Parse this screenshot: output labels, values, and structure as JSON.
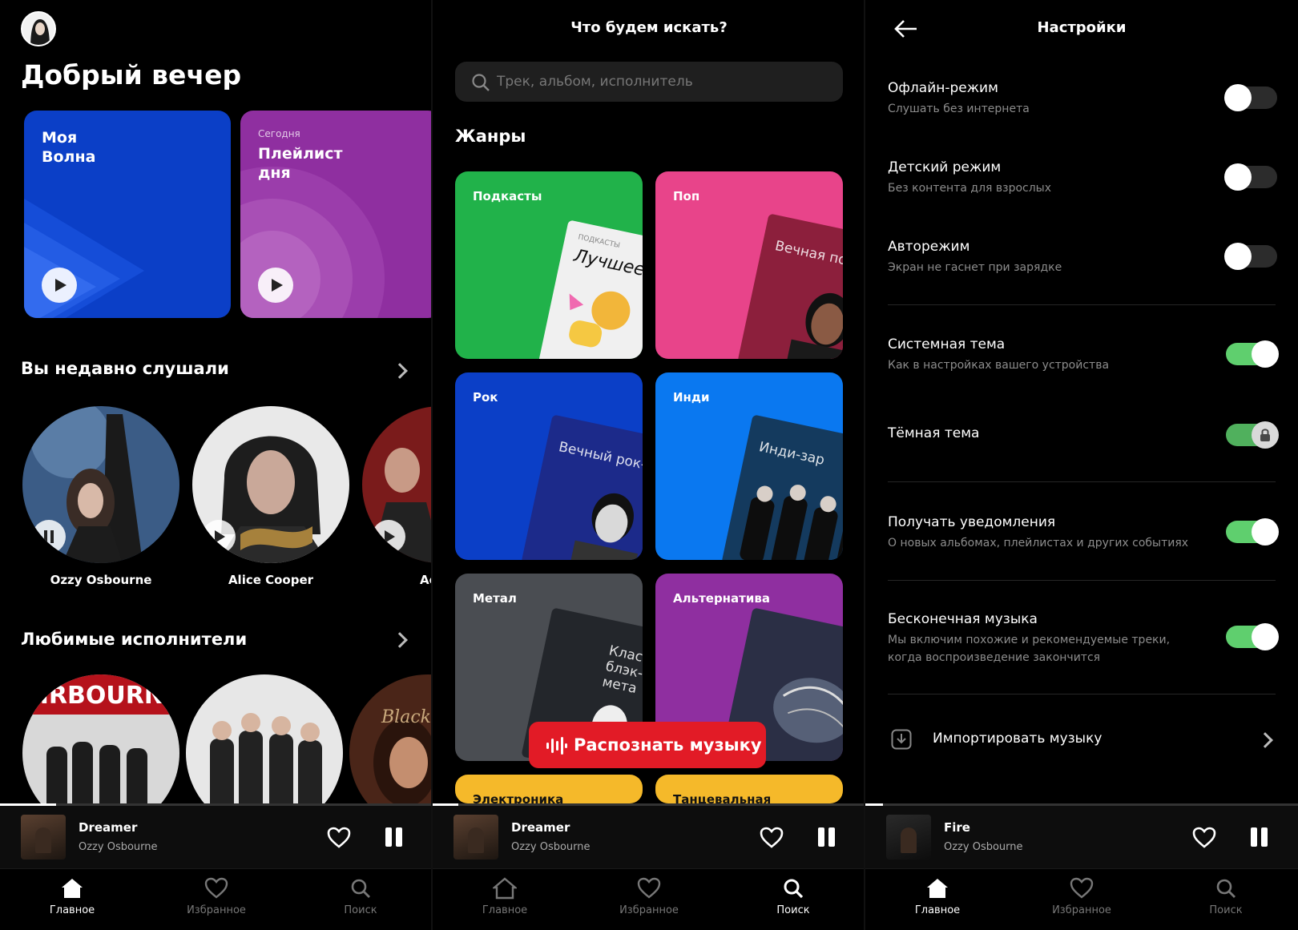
{
  "home": {
    "greeting": "Добрый вечер",
    "promos": [
      {
        "title_line1": "Моя",
        "title_line2": "Волна",
        "subtitle": ""
      },
      {
        "title_line1": "Плейлист",
        "title_line2": "дня",
        "subtitle": "Сегодня"
      }
    ],
    "recent_title": "Вы недавно слушали",
    "recent": [
      {
        "name": "Ozzy Osbourne",
        "state": "pause"
      },
      {
        "name": "Alice Cooper",
        "state": "play"
      },
      {
        "name": "Ac",
        "state": "play"
      }
    ],
    "favorites_title": "Любимые исполнители",
    "favorites_banner": "AIRBOURNE",
    "favorites_script": "Black Velvet"
  },
  "search": {
    "header": "Что будем искать?",
    "placeholder": "Трек, альбом, исполнитель",
    "genres_title": "Жанры",
    "genres": [
      {
        "label": "Подкасты",
        "card": "Лучшее",
        "card_small": "ПОДКАСТЫ",
        "color": "#21b24a"
      },
      {
        "label": "Поп",
        "card": "Вечная поп-м",
        "card_small": "",
        "color": "#e8448a"
      },
      {
        "label": "Рок",
        "card": "Вечный рок-н",
        "card_small": "",
        "color": "#0b3fc7"
      },
      {
        "label": "Инди",
        "card": "Инди-зар",
        "card_small": "",
        "color": "#0a78f0"
      },
      {
        "label": "Метал",
        "card": "Классич блэк-мета",
        "card_small": "",
        "color": "#4a4d52"
      },
      {
        "label": "Альтернатива",
        "card": "",
        "card_small": "",
        "color": "#8f2fa0"
      },
      {
        "label": "Электроника",
        "card": "",
        "card_small": "",
        "color": "#f5b92a"
      },
      {
        "label": "Танцевальная",
        "card": "",
        "card_small": "",
        "color": "#f5b92a"
      }
    ],
    "recognize": "Распознать музыку"
  },
  "settings": {
    "header": "Настройки",
    "items": [
      {
        "title": "Офлайн-режим",
        "subtitle": "Слушать без интернета",
        "on": false
      },
      {
        "title": "Детский режим",
        "subtitle": "Без контента для взрослых",
        "on": false
      },
      {
        "title": "Авторежим",
        "subtitle": "Экран не гаснет при зарядке",
        "on": false
      },
      {
        "title": "Системная тема",
        "subtitle": "Как в настройках вашего устройства",
        "on": true
      },
      {
        "title": "Тёмная тема",
        "subtitle": "",
        "on": true,
        "locked": true
      },
      {
        "title": "Получать уведомления",
        "subtitle": "О новых альбомах, плейлистах и других событиях",
        "on": true
      },
      {
        "title": "Бесконечная музыка",
        "subtitle": "Мы включим похожие и рекомендуемые треки, когда воспроизведение закончится",
        "on": true
      }
    ],
    "import_label": "Импортировать музыку"
  },
  "players": [
    {
      "title": "Dreamer",
      "artist": "Ozzy Osbourne",
      "progress": 0.13
    },
    {
      "title": "Dreamer",
      "artist": "Ozzy Osbourne",
      "progress": 0.06
    },
    {
      "title": "Fire",
      "artist": "Ozzy Osbourne",
      "progress": 0.04
    }
  ],
  "nav": {
    "home": "Главное",
    "favorites": "Избранное",
    "search": "Поиск"
  },
  "colors": {
    "accent_red": "#e21b26",
    "toggle_on": "#5fcf6e",
    "wave_blue": "#0b3fc7",
    "playlist_purple": "#9c3fa8"
  }
}
